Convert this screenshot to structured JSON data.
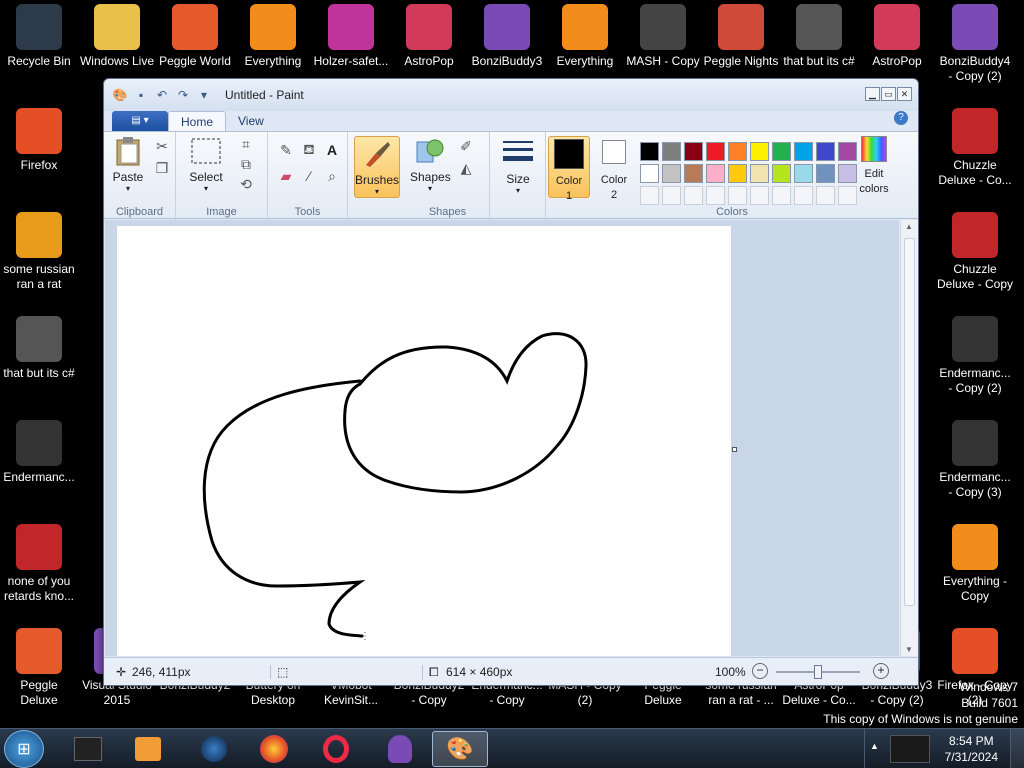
{
  "desktop": {
    "icons": [
      {
        "label": "Recycle Bin"
      },
      {
        "label": "Windows Live"
      },
      {
        "label": "Peggle World"
      },
      {
        "label": "Everything"
      },
      {
        "label": "Holzer-safet..."
      },
      {
        "label": "AstroPop"
      },
      {
        "label": "BonziBuddy3"
      },
      {
        "label": "Everything"
      },
      {
        "label": "MASH - Copy"
      },
      {
        "label": "Peggle Nights"
      },
      {
        "label": "that but its c#"
      },
      {
        "label": "AstroPop"
      },
      {
        "label": "BonziBuddy4\n- Copy (2)"
      },
      {
        "label": "Firefox"
      },
      {
        "label": "Chuzzle\nDeluxe - Co..."
      },
      {
        "label": "some russian\nran a rat"
      },
      {
        "label": "Chuzzle\nDeluxe - Copy"
      },
      {
        "label": "that but its c#"
      },
      {
        "label": "Endermanc...\n- Copy (2)"
      },
      {
        "label": "Endermanc..."
      },
      {
        "label": "Endermanc...\n- Copy (3)"
      },
      {
        "label": "none of you\nretards kno..."
      },
      {
        "label": "Everything -\nCopy"
      },
      {
        "label": "Peggle Deluxe"
      },
      {
        "label": "Visual Studio\n2015"
      },
      {
        "label": "BonziBuddy2"
      },
      {
        "label": "Buttery on\nDesktop"
      },
      {
        "label": "VMobot\nKevinSit..."
      },
      {
        "label": "BonziBuddy2\n- Copy"
      },
      {
        "label": "Endermanc...\n- Copy"
      },
      {
        "label": "MASH - Copy\n(2)"
      },
      {
        "label": "Peggle Deluxe"
      },
      {
        "label": "some russian\nran a rat - ..."
      },
      {
        "label": "AstroPop\nDeluxe - Co..."
      },
      {
        "label": "BonziBuddy3\n- Copy (2)"
      },
      {
        "label": "Firefox - Copy\n(2)"
      }
    ],
    "watermark": {
      "line1": "Windows 7",
      "line2": "Build 7601",
      "line3": "This copy of Windows is not genuine"
    }
  },
  "paint": {
    "title": "Untitled - Paint",
    "tabs": [
      "Home",
      "View"
    ],
    "groups": {
      "clipboard": {
        "label": "Clipboard",
        "paste": "Paste"
      },
      "image": {
        "label": "Image",
        "select": "Select"
      },
      "tools": {
        "label": "Tools"
      },
      "brushes": {
        "label": "Brushes"
      },
      "shapes": {
        "label": "Shapes",
        "shapes_btn": "Shapes"
      },
      "size": {
        "label": "Size"
      },
      "colors": {
        "label": "Colors",
        "color1": "Color\n1",
        "color2": "Color\n2",
        "edit": "Edit\ncolors"
      }
    },
    "palette_row1": [
      "#000000",
      "#7f7f7f",
      "#880015",
      "#ed1c24",
      "#ff7f27",
      "#fff200",
      "#22b14c",
      "#00a2e8",
      "#3f48cc",
      "#a349a4"
    ],
    "palette_row2": [
      "#ffffff",
      "#c3c3c3",
      "#b97a57",
      "#ffaec9",
      "#ffc90e",
      "#efe4b0",
      "#b5e61d",
      "#99d9ea",
      "#7092be",
      "#c8bfe7"
    ],
    "color1_value": "#000000",
    "color2_value": "#ffffff",
    "status": {
      "cursor_pos": "246, 411px",
      "canvas_size": "614 × 460px",
      "zoom": "100%"
    }
  },
  "taskbar": {
    "time": "8:54 PM",
    "date": "7/31/2024"
  }
}
